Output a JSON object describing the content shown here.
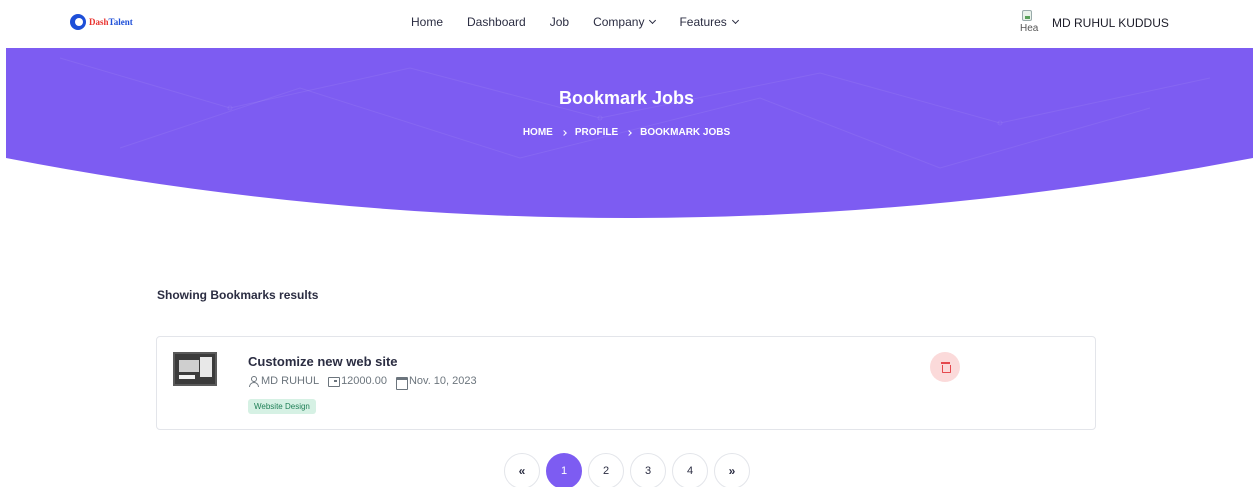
{
  "navbar": {
    "logo": {
      "part1": "Dash",
      "part2": "Talent"
    },
    "items": [
      {
        "label": "Home",
        "dropdown": false
      },
      {
        "label": "Dashboard",
        "dropdown": false
      },
      {
        "label": "Job",
        "dropdown": false
      },
      {
        "label": "Company",
        "dropdown": true
      },
      {
        "label": "Features",
        "dropdown": true
      }
    ],
    "user": {
      "avatar_alt": "Hea",
      "name": "MD RUHUL KUDDUS"
    }
  },
  "hero": {
    "title": "Bookmark Jobs",
    "breadcrumb": [
      "HOME",
      "PROFILE",
      "BOOKMARK JOBS"
    ],
    "color": "#7d5cf2"
  },
  "results": {
    "heading": "Showing Bookmarks results",
    "jobs": [
      {
        "title": "Customize new web site",
        "author": "MD RUHUL",
        "salary": "12000.00",
        "date": "Nov. 10, 2023",
        "tag": "Website Design"
      }
    ]
  },
  "pagination": {
    "prev": "«",
    "pages": [
      "1",
      "2",
      "3",
      "4"
    ],
    "active": "1",
    "next": "»"
  }
}
